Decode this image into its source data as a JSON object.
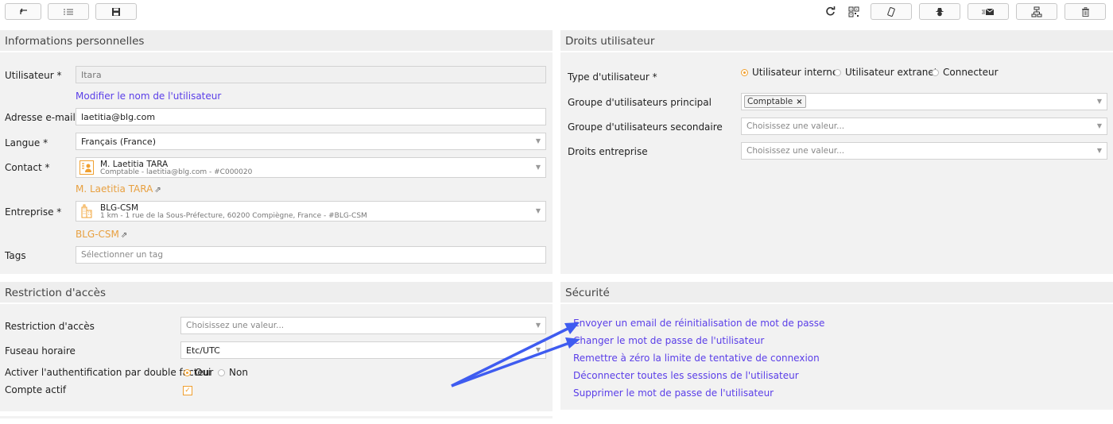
{
  "toolbar": {
    "left_icons": [
      "back-arrow-icon",
      "list-icon",
      "save-icon"
    ],
    "right_icons": [
      "refresh-icon",
      "qr-code-icon",
      "mobile-icon",
      "spy-icon",
      "email-icon",
      "org-chart-icon",
      "trash-icon"
    ]
  },
  "personal": {
    "title": "Informations personnelles",
    "user_label": "Utilisateur *",
    "user_value": "Itara",
    "rename_link": "Modifier le nom de l'utilisateur",
    "email_label": "Adresse e-mail *",
    "email_value": "laetitia@blg.com",
    "lang_label": "Langue *",
    "lang_value": "Français (France)",
    "contact_label": "Contact *",
    "contact_name": "M. Laetitia TARA",
    "contact_sub": "Comptable - laetitia@blg.com - #C000020",
    "contact_link": "M. Laetitia TARA",
    "company_label": "Entreprise *",
    "company_name": "BLG-CSM",
    "company_sub": "1 km - 1 rue de la Sous-Préfecture, 60200 Compiègne, France - #BLG-CSM",
    "company_link": "BLG-CSM",
    "tags_label": "Tags",
    "tags_placeholder": "Sélectionner un tag"
  },
  "rights": {
    "title": "Droits utilisateur",
    "type_label": "Type d'utilisateur *",
    "type_options": [
      "Utilisateur interne",
      "Utilisateur extranet",
      "Connecteur"
    ],
    "type_selected": 0,
    "main_group_label": "Groupe d'utilisateurs principal",
    "main_group_tag": "Comptable",
    "secondary_group_label": "Groupe d'utilisateurs secondaire",
    "secondary_group_placeholder": "Choisissez une valeur...",
    "company_rights_label": "Droits entreprise",
    "company_rights_placeholder": "Choisissez une valeur..."
  },
  "access": {
    "title": "Restriction d'accès",
    "restriction_label": "Restriction d'accès",
    "restriction_placeholder": "Choisissez une valeur...",
    "timezone_label": "Fuseau horaire",
    "timezone_value": "Etc/UTC",
    "twofa_label": "Activer l'authentification par double facteur",
    "twofa_yes": "Oui",
    "twofa_no": "Non",
    "active_label": "Compte actif",
    "active_checked": true
  },
  "security": {
    "title": "Sécurité",
    "links": [
      "Envoyer un email de réinitialisation de mot de passe",
      "Changer le mot de passe de l'utilisateur",
      "Remettre à zéro la limite de tentative de connexion",
      "Déconnecter toutes les sessions de l'utilisateur",
      "Supprimer le mot de passe de l'utilisateur"
    ]
  },
  "colors": {
    "link": "#5a3ee8",
    "orange": "#e8a040",
    "arrow": "#3f5cf0"
  }
}
